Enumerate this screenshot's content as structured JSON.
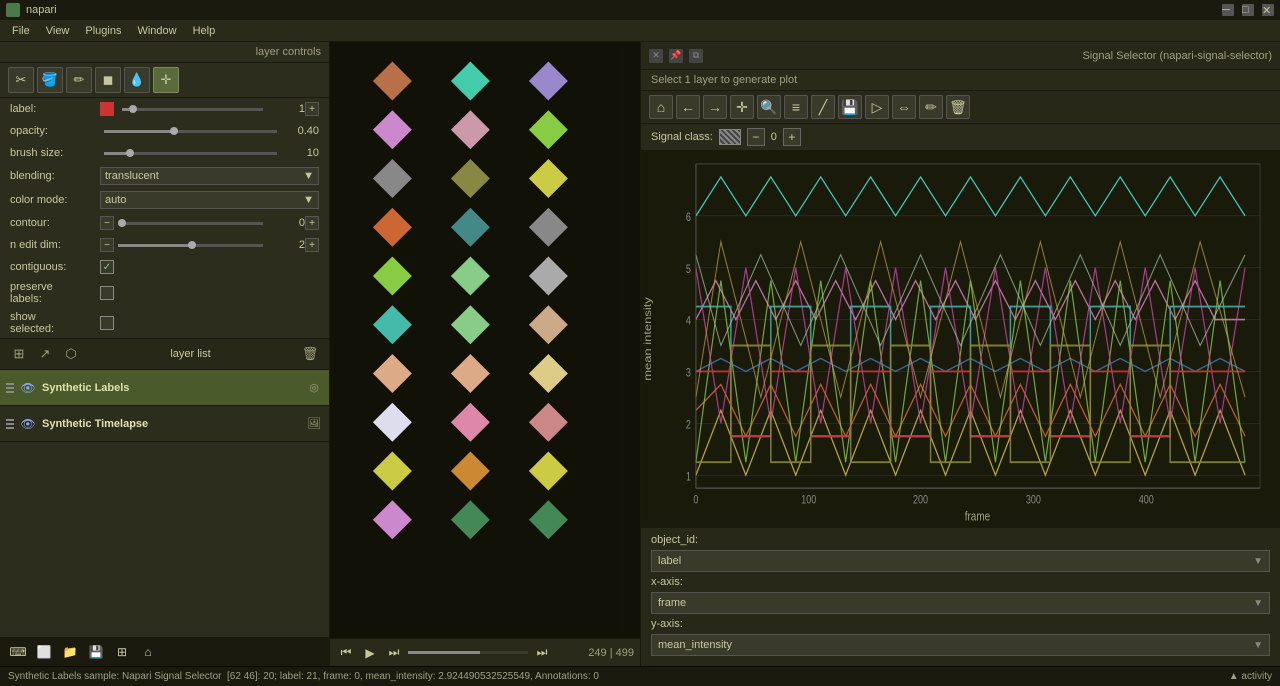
{
  "app": {
    "title": "napari"
  },
  "titlebar": {
    "controls": [
      "minimize",
      "maximize",
      "close"
    ]
  },
  "menubar": {
    "items": [
      "File",
      "View",
      "Plugins",
      "Window",
      "Help"
    ]
  },
  "layer_controls": {
    "header": "layer controls",
    "tools": [
      "scissors",
      "paintbucket",
      "pencil",
      "fillpencil",
      "eyedropper",
      "move"
    ],
    "label_label": "label:",
    "label_value": "1",
    "opacity_label": "opacity:",
    "opacity_value": "0.40",
    "brush_size_label": "brush size:",
    "brush_size_value": "10",
    "blending_label": "blending:",
    "blending_value": "translucent",
    "color_mode_label": "color mode:",
    "color_mode_value": "auto",
    "contour_label": "contour:",
    "contour_value": "0",
    "n_edit_dim_label": "n edit dim:",
    "n_edit_dim_value": "2",
    "contiguous_label": "contiguous:",
    "contiguous_checked": true,
    "preserve_labels_label": "preserve\nlabels:",
    "show_selected_label": "show\nselected:"
  },
  "layer_list": {
    "header": "layer list",
    "tools": [
      "grid",
      "arrow",
      "lasso",
      "delete"
    ],
    "layers": [
      {
        "name": "Synthetic Labels",
        "type": "labels",
        "visible": true,
        "active": true
      },
      {
        "name": "Synthetic Timelapse",
        "type": "image",
        "visible": true,
        "active": false
      }
    ]
  },
  "statusbar": {
    "layer": "Synthetic Labels",
    "sample_label": "sample:",
    "plugin": "Napari Signal Selector",
    "coords": "[62 46]: 20; label: 21, frame: 0, mean_intensity: 2.924490532525549, Annotations: 0"
  },
  "bottom_toolbar": {
    "buttons": [
      "terminal",
      "square",
      "folder-open",
      "save",
      "grid",
      "home"
    ],
    "position": "249 | 499"
  },
  "signal_selector": {
    "title": "Signal Selector (napari-signal-selector)",
    "subtitle": "Select 1 layer to generate plot",
    "plot_tools": [
      "home",
      "back",
      "forward",
      "pan",
      "zoom",
      "settings",
      "trendline",
      "save",
      "select",
      "span",
      "brush",
      "delete"
    ],
    "signal_class_label": "Signal class:",
    "signal_class_value": "0",
    "object_id_label": "object_id:",
    "x_axis_label": "x-axis:",
    "x_axis_value": "frame",
    "y_axis_label": "y-axis:",
    "y_axis_value": "mean_intensity",
    "dropdown_label_value": "label",
    "y_axis_ticks": [
      "1",
      "2",
      "3",
      "4",
      "5",
      "6"
    ],
    "x_axis_ticks": [
      "0",
      "100",
      "200",
      "300",
      "400"
    ],
    "x_axis_title": "frame",
    "y_axis_title": "mean intensity"
  },
  "canvas": {
    "shapes": [
      {
        "col": 0,
        "row": 0,
        "color": "#b87048",
        "shape": "diamond"
      },
      {
        "col": 0,
        "row": 1,
        "color": "#cc88cc",
        "shape": "diamond"
      },
      {
        "col": 0,
        "row": 2,
        "color": "#888888",
        "shape": "diamond"
      },
      {
        "col": 0,
        "row": 3,
        "color": "#cc6633",
        "shape": "diamond"
      },
      {
        "col": 0,
        "row": 4,
        "color": "#88cc44",
        "shape": "diamond"
      },
      {
        "col": 0,
        "row": 5,
        "color": "#44ccaa",
        "shape": "diamond"
      },
      {
        "col": 0,
        "row": 6,
        "color": "#ddaa88",
        "shape": "diamond"
      },
      {
        "col": 0,
        "row": 7,
        "color": "#ddccdd",
        "shape": "diamond"
      },
      {
        "col": 0,
        "row": 8,
        "color": "#cccc44",
        "shape": "diamond"
      },
      {
        "col": 0,
        "row": 9,
        "color": "#cc88cc",
        "shape": "diamond"
      },
      {
        "col": 1,
        "row": 0,
        "color": "#44ccaa",
        "shape": "diamond"
      },
      {
        "col": 1,
        "row": 1,
        "color": "#cc99aa",
        "shape": "diamond"
      },
      {
        "col": 1,
        "row": 2,
        "color": "#888844",
        "shape": "diamond"
      },
      {
        "col": 1,
        "row": 3,
        "color": "#448888",
        "shape": "diamond"
      },
      {
        "col": 1,
        "row": 4,
        "color": "#88aa44",
        "shape": "diamond"
      },
      {
        "col": 1,
        "row": 5,
        "color": "#88cc88",
        "shape": "diamond"
      },
      {
        "col": 1,
        "row": 6,
        "color": "#ddaa88",
        "shape": "diamond"
      },
      {
        "col": 1,
        "row": 7,
        "color": "#dd88aa",
        "shape": "diamond"
      },
      {
        "col": 1,
        "row": 8,
        "color": "#cc8833",
        "shape": "diamond"
      },
      {
        "col": 1,
        "row": 9,
        "color": "#448855",
        "shape": "diamond"
      },
      {
        "col": 2,
        "row": 0,
        "color": "#9988cc",
        "shape": "diamond"
      },
      {
        "col": 2,
        "row": 1,
        "color": "#88cc44",
        "shape": "diamond"
      },
      {
        "col": 2,
        "row": 2,
        "color": "#cccc44",
        "shape": "diamond"
      },
      {
        "col": 2,
        "row": 3,
        "color": "#888888",
        "shape": "diamond"
      },
      {
        "col": 2,
        "row": 4,
        "color": "#888888",
        "shape": "diamond"
      },
      {
        "col": 2,
        "row": 5,
        "color": "#ccaa88",
        "shape": "diamond"
      },
      {
        "col": 2,
        "row": 6,
        "color": "#cccc88",
        "shape": "diamond"
      },
      {
        "col": 2,
        "row": 7,
        "color": "#cc8888",
        "shape": "diamond"
      },
      {
        "col": 2,
        "row": 8,
        "color": "#cccc44",
        "shape": "diamond"
      },
      {
        "col": 2,
        "row": 9,
        "color": "#448855",
        "shape": "diamond"
      }
    ]
  }
}
